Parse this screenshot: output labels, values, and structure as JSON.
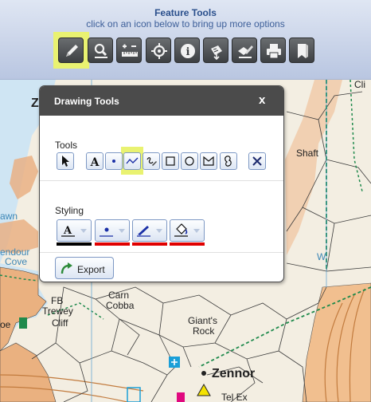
{
  "feature_tools": {
    "title": "Feature Tools",
    "subtitle": "click on an icon below to bring up more options",
    "buttons": [
      {
        "icon": "pencil-icon",
        "name": "draw"
      },
      {
        "icon": "magnifier-icon",
        "name": "search"
      },
      {
        "icon": "ruler-icon",
        "name": "measure"
      },
      {
        "icon": "crosshair-icon",
        "name": "locate"
      },
      {
        "icon": "info-icon",
        "name": "info"
      },
      {
        "icon": "map-pointer-icon",
        "name": "map-point"
      },
      {
        "icon": "signpost-edit-icon",
        "name": "edit-route"
      },
      {
        "icon": "printer-icon",
        "name": "print"
      },
      {
        "icon": "bookmark-icon",
        "name": "bookmark"
      }
    ],
    "highlight_color": "#e9f271"
  },
  "drawing_panel": {
    "title": "Drawing Tools",
    "close_glyph": "x",
    "tools_label": "Tools",
    "tools": [
      {
        "icon": "select-arrow-icon",
        "name": "select"
      },
      {
        "icon": "text-icon",
        "name": "text",
        "glyph": "A"
      },
      {
        "icon": "point-icon",
        "name": "point"
      },
      {
        "icon": "polyline-icon",
        "name": "line"
      },
      {
        "icon": "freehand-icon",
        "name": "freehand"
      },
      {
        "icon": "rectangle-icon",
        "name": "rectangle"
      },
      {
        "icon": "circle-icon",
        "name": "circle"
      },
      {
        "icon": "polygon-icon",
        "name": "polygon"
      },
      {
        "icon": "freeform-shape-icon",
        "name": "freeform"
      },
      {
        "icon": "delete-icon",
        "name": "delete"
      }
    ],
    "styling_label": "Styling",
    "styles": [
      {
        "icon": "font-color-icon",
        "name": "text-style",
        "glyph": "A",
        "color": "#000000"
      },
      {
        "icon": "point-color-icon",
        "name": "point-style",
        "color": "#e00000"
      },
      {
        "icon": "line-color-icon",
        "name": "line-style",
        "color": "#e00000"
      },
      {
        "icon": "fill-color-icon",
        "name": "fill-style",
        "color": "#e00000"
      }
    ],
    "export_label": "Export",
    "export_icon": "export-arrow-icon"
  },
  "map": {
    "labels": {
      "z": "Z",
      "shaft": "Shaft",
      "awn": "awn",
      "endour": "endour",
      "cove": "Cove",
      "w": "W",
      "fb": "FB",
      "trewey": "Trewey",
      "cliff": "Cliff",
      "carn": "Carn",
      "cobba": "Cobba",
      "giants": "Giant's",
      "rock": "Rock",
      "zennor": "Zennor",
      "oe": "oe",
      "tel_ex": "Tel Ex",
      "cli": "Cli"
    },
    "colors": {
      "sea": "#cce5f4",
      "land": "#f2ede2",
      "cliff": "#e8a66e",
      "field_line": "#444444",
      "path_green": "#1f8a4c"
    }
  }
}
